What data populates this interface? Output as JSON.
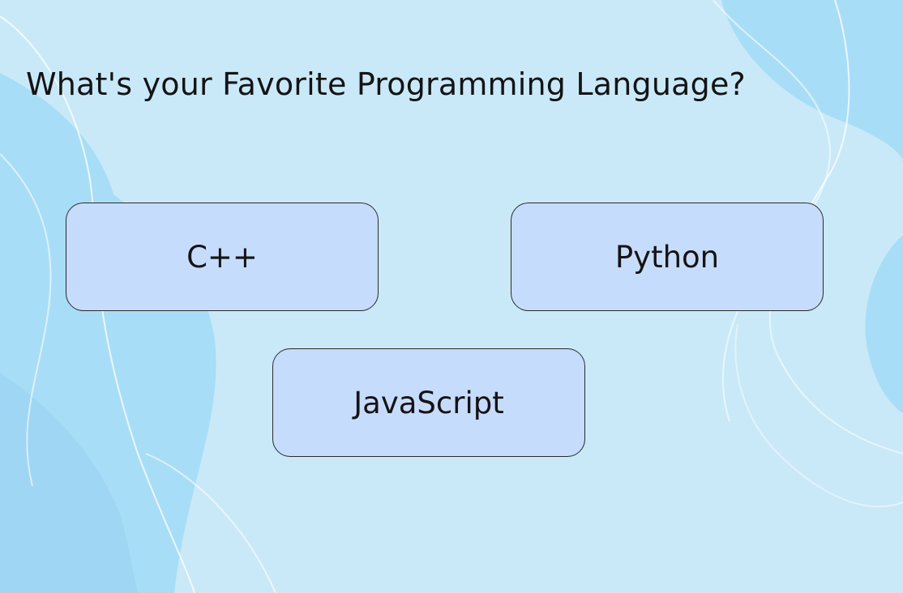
{
  "question": "What's your Favorite Programming Language?",
  "options": [
    {
      "label": "C++"
    },
    {
      "label": "Python"
    },
    {
      "label": "JavaScript"
    }
  ],
  "colors": {
    "background": "#c9e9f9",
    "blob": "#a8ddf7",
    "card": "#c6dcfc",
    "card_border": "#2a2a2a",
    "text": "#141414"
  }
}
